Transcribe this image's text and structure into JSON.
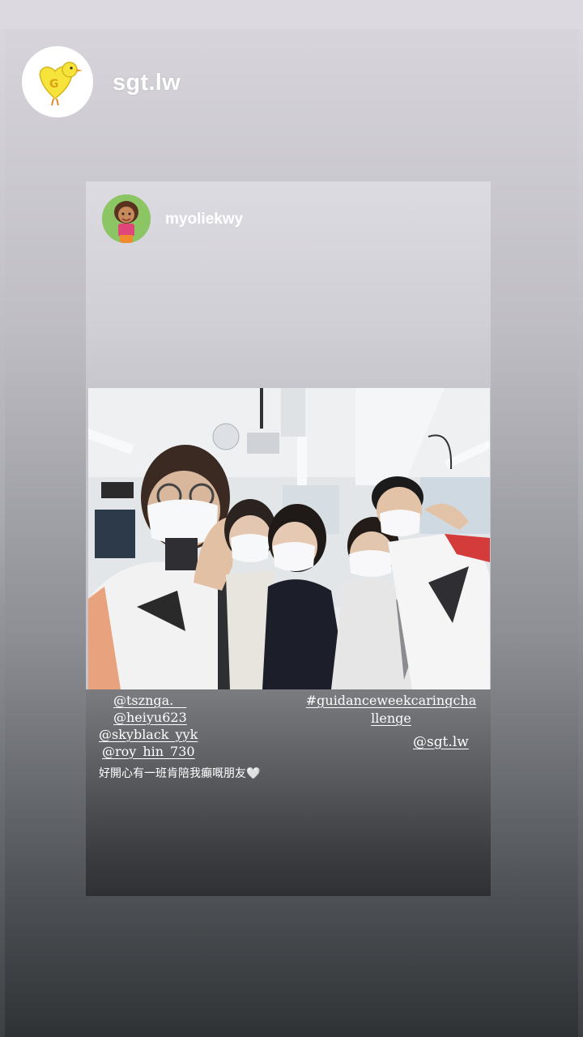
{
  "story": {
    "owner_username": "sgt.lw",
    "owner_avatar_icon": "yellow-chick-heart-icon"
  },
  "reshared_post": {
    "username": "myoliekwy",
    "avatar_icon": "cartoon-girl-avatar",
    "mentions": [
      "@tszngа.__",
      "@heiyu623",
      "@skyblack_yyk",
      "@roy_hin_730"
    ],
    "caption": "好開心有一班肯陪我癲嘅朋友🤍",
    "hashtag": "#guidanceweekcaringchallenge",
    "hashtag_mention": "@sgt.lw",
    "photo_description_icon": "group-selfie-photo"
  }
}
